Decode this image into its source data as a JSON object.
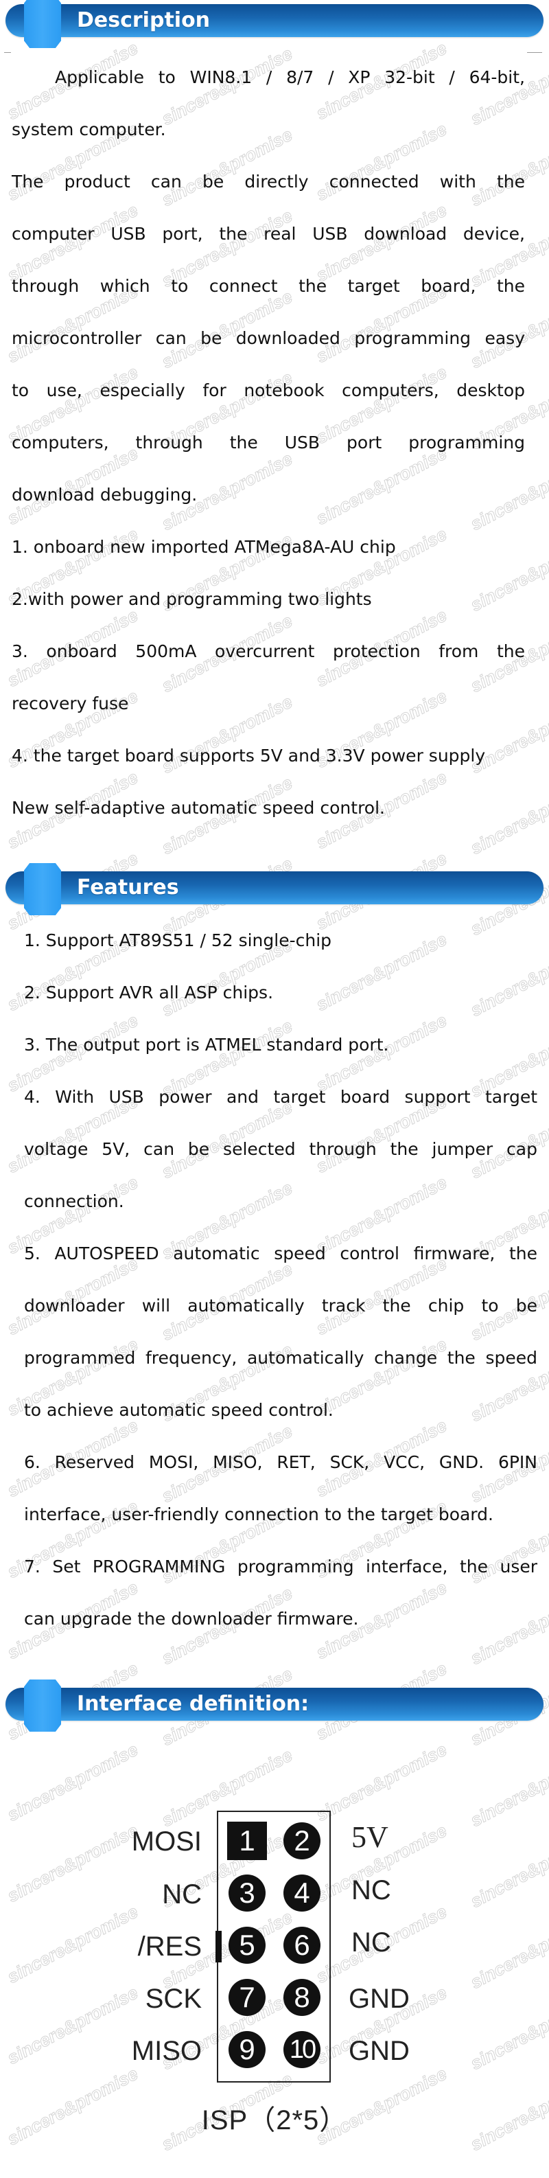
{
  "watermark": "sincere&promise",
  "colors": {
    "header_bar_dark": "#0d4f94",
    "header_bar_light": "#3da2ea",
    "header_nut": "#40aaf8",
    "header_text": "#ffffff",
    "body_text": "#111111",
    "pin_fill": "#111111"
  },
  "description": {
    "title": "Description",
    "lines": [
      "Applicable to WIN8.1 / 8/7 / XP 32-bit / 64-bit,",
      "system computer.",
      "The product can be directly connected with the",
      "computer USB port, the real USB download device,",
      "through which to connect the target board, the",
      "microcontroller can be downloaded programming easy",
      "to use, especially for notebook computers, desktop",
      "computers, through the USB port programming",
      "download debugging.",
      "1. onboard new imported ATMega8A-AU chip",
      "2.with power and programming two lights",
      "3. onboard 500mA overcurrent protection from the",
      "recovery fuse",
      "4. the target board supports 5V and 3.3V power supply",
      "New self-adaptive automatic speed control."
    ]
  },
  "features": {
    "title": "Features",
    "lines": [
      "1. Support AT89S51 / 52 single-chip",
      "2. Support AVR all ASP chips.",
      "3. The output port is ATMEL standard port.",
      "4. With USB power and target board support target",
      "voltage 5V, can be selected through the jumper cap",
      "connection.",
      "5. AUTOSPEED automatic speed control firmware, the",
      "downloader will automatically track the chip to be",
      "programmed frequency, automatically change the speed",
      "to achieve automatic speed control.",
      "6. Reserved MOSI, MISO, RET, SCK, VCC, GND. 6PIN",
      "interface, user-friendly connection to the target board.",
      "7. Set PROGRAMMING programming interface, the user",
      "can upgrade the downloader firmware."
    ]
  },
  "interface": {
    "title": "Interface definition:",
    "caption": "ISP（2*5）",
    "pins": [
      {
        "number": "1",
        "signal": "MOSI"
      },
      {
        "number": "2",
        "signal": "5V"
      },
      {
        "number": "3",
        "signal": "NC"
      },
      {
        "number": "4",
        "signal": "NC"
      },
      {
        "number": "5",
        "signal": "/RES"
      },
      {
        "number": "6",
        "signal": "NC"
      },
      {
        "number": "7",
        "signal": "SCK"
      },
      {
        "number": "8",
        "signal": "GND"
      },
      {
        "number": "9",
        "signal": "MISO"
      },
      {
        "number": "10",
        "signal": "GND"
      }
    ]
  }
}
